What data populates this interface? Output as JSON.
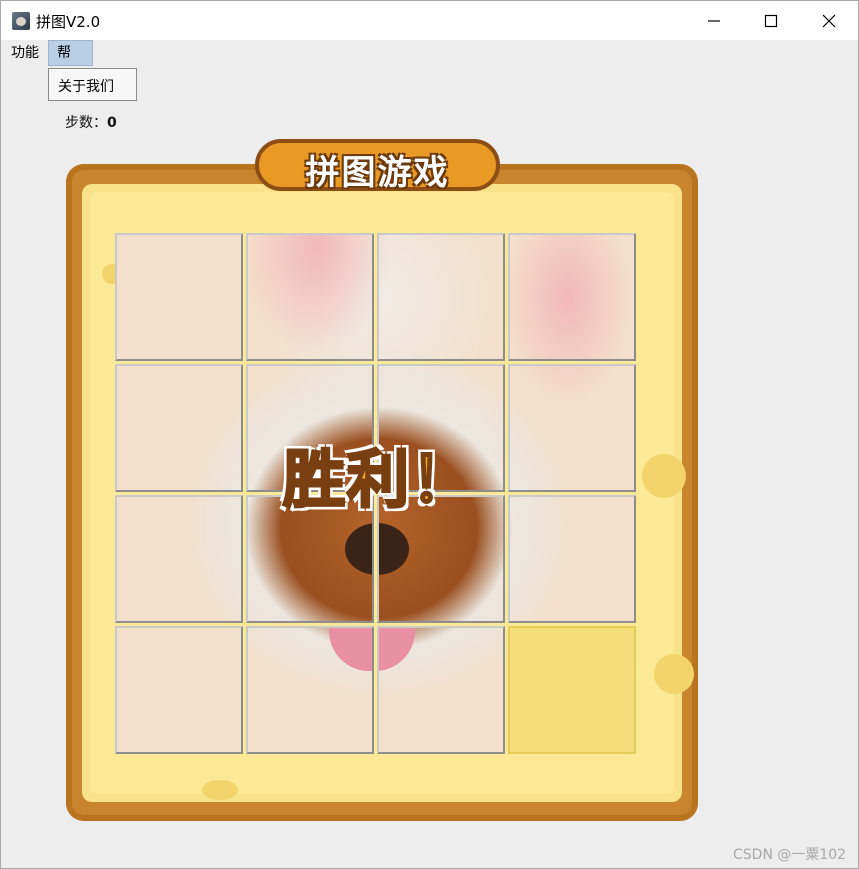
{
  "window": {
    "title": "拼图V2.0"
  },
  "menu": {
    "items": [
      {
        "label": "功能"
      },
      {
        "label": "帮助"
      }
    ]
  },
  "dropdown": {
    "items": [
      {
        "label": "关于我们"
      }
    ]
  },
  "status": {
    "steps_label": "步数：",
    "steps_value": "0"
  },
  "game": {
    "banner": "拼图游戏",
    "victory": "胜利！"
  },
  "watermark": "CSDN @一粟102",
  "colors": {
    "frame": "#c8852e",
    "inner": "#f8e38a",
    "banner": "#e99a24",
    "victory": "#f3a52d",
    "empty_tile": "#f4de7c",
    "menu_highlight": "#b8cfe6"
  },
  "icons": {
    "app": "puzzle-app-icon",
    "minimize": "minimize-icon",
    "maximize": "maximize-icon",
    "close": "close-icon"
  }
}
